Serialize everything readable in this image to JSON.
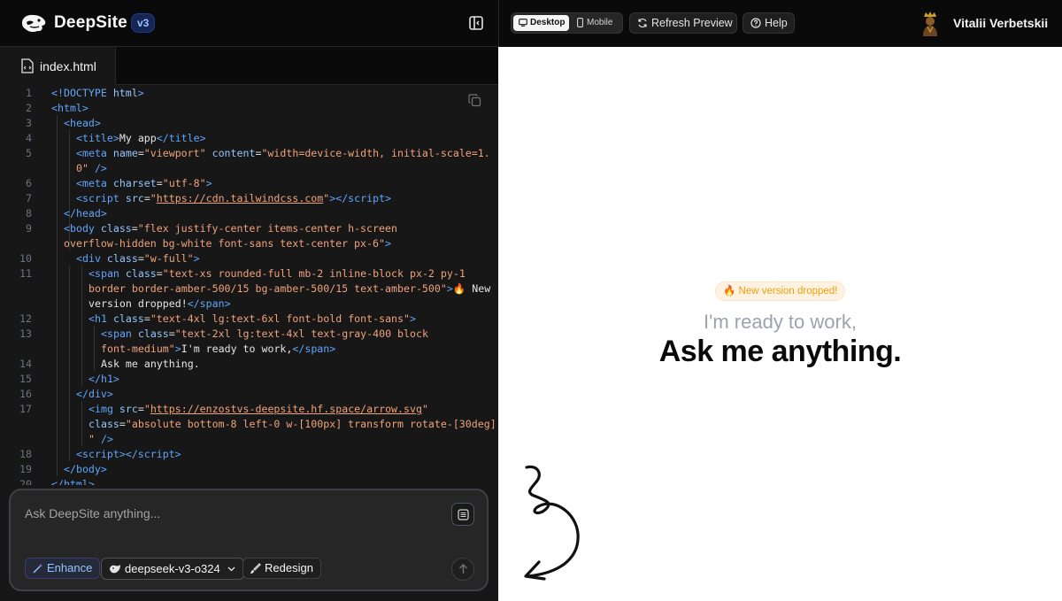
{
  "header": {
    "brand": "DeepSite",
    "version": "v3"
  },
  "file_tab": {
    "name": "index.html"
  },
  "code_lines": [
    {
      "n": "1",
      "html": "<span class='tg'>&lt;!DOCTYPE</span> <span class='at'>html</span><span class='tg'>&gt;</span>",
      "indent": 0
    },
    {
      "n": "2",
      "html": "<span class='tg'>&lt;html&gt;</span>",
      "indent": 0
    },
    {
      "n": "3",
      "html": "<span class='tg'>&lt;head&gt;</span>",
      "indent": 1
    },
    {
      "n": "4",
      "html": "<span class='tg'>&lt;title&gt;</span><span class='pl'>My app</span><span class='tg'>&lt;/title&gt;</span>",
      "indent": 2
    },
    {
      "n": "5",
      "html": "<span class='tg'>&lt;meta</span> <span class='at'>name</span>=<span class='st'>\"viewport\"</span> <span class='at'>content</span>=<span class='st'>\"width=device-width, initial-scale=1.</span>",
      "indent": 2
    },
    {
      "n": "",
      "html": "<span class='st'>0\"</span> <span class='tg'>/&gt;</span>",
      "indent": 2
    },
    {
      "n": "6",
      "html": "<span class='tg'>&lt;meta</span> <span class='at'>charset</span>=<span class='st'>\"utf-8\"</span><span class='tg'>&gt;</span>",
      "indent": 2
    },
    {
      "n": "7",
      "html": "<span class='tg'>&lt;script</span> <span class='at'>src</span>=<span class='st'>\"<span class='ul'>https://cdn.tailwindcss.com</span>\"</span><span class='tg'>&gt;&lt;/script&gt;</span>",
      "indent": 2
    },
    {
      "n": "8",
      "html": "<span class='tg'>&lt;/head&gt;</span>",
      "indent": 1
    },
    {
      "n": "9",
      "html": "<span class='tg'>&lt;body</span> <span class='at'>class</span>=<span class='st'>\"flex justify-center items-center h-screen</span>",
      "indent": 1
    },
    {
      "n": "",
      "html": "<span class='st'>overflow-hidden bg-white font-sans text-center px-6\"</span><span class='tg'>&gt;</span>",
      "indent": 1
    },
    {
      "n": "10",
      "html": "<span class='tg'>&lt;div</span> <span class='at'>class</span>=<span class='st'>\"w-full\"</span><span class='tg'>&gt;</span>",
      "indent": 2
    },
    {
      "n": "11",
      "html": "<span class='tg'>&lt;span</span> <span class='at'>class</span>=<span class='st'>\"text-xs rounded-full mb-2 inline-block px-2 py-1</span>",
      "indent": 3
    },
    {
      "n": "",
      "html": "<span class='st'>border border-amber-500/15 bg-amber-500/15 text-amber-500\"</span><span class='tg'>&gt;</span><span class='pl'>🔥 New</span>",
      "indent": 3
    },
    {
      "n": "",
      "html": "<span class='pl'>version dropped!</span><span class='tg'>&lt;/span&gt;</span>",
      "indent": 3
    },
    {
      "n": "12",
      "html": "<span class='tg'>&lt;h1</span> <span class='at'>class</span>=<span class='st'>\"text-4xl lg:text-6xl font-bold font-sans\"</span><span class='tg'>&gt;</span>",
      "indent": 3
    },
    {
      "n": "13",
      "html": "<span class='tg'>&lt;span</span> <span class='at'>class</span>=<span class='st'>\"text-2xl lg:text-4xl text-gray-400 block</span>",
      "indent": 4
    },
    {
      "n": "",
      "html": "<span class='st'>font-medium\"</span><span class='tg'>&gt;</span><span class='pl'>I'm ready to work,</span><span class='tg'>&lt;/span&gt;</span>",
      "indent": 4
    },
    {
      "n": "14",
      "html": "<span class='pl'>Ask me anything.</span>",
      "indent": 4
    },
    {
      "n": "15",
      "html": "<span class='tg'>&lt;/h1&gt;</span>",
      "indent": 3
    },
    {
      "n": "16",
      "html": "<span class='tg'>&lt;/div&gt;</span>",
      "indent": 2
    },
    {
      "n": "17",
      "html": "<span class='tg'>&lt;img</span> <span class='at'>src</span>=<span class='st'>\"<span class='ul'>https://enzostvs-deepsite.hf.space/arrow.svg</span>\"</span>",
      "indent": 3
    },
    {
      "n": "",
      "html": "<span class='at'>class</span>=<span class='st'>\"absolute bottom-8 left-0 w-[100px] transform rotate-[30deg]</span>",
      "indent": 3
    },
    {
      "n": "",
      "html": "<span class='st'>\"</span> <span class='tg'>/&gt;</span>",
      "indent": 3
    },
    {
      "n": "18",
      "html": "<span class='tg'>&lt;script&gt;&lt;/script&gt;</span>",
      "indent": 2
    },
    {
      "n": "19",
      "html": "<span class='tg'>&lt;/body&gt;</span>",
      "indent": 1
    },
    {
      "n": "20",
      "html": "<span class='tg'>&lt;/html&gt;</span>",
      "indent": 0
    }
  ],
  "prompt": {
    "placeholder": "Ask DeepSite anything...",
    "enhance_label": "Enhance",
    "model_label": "deepseek-v3-o324",
    "redesign_label": "Redesign"
  },
  "preview_toolbar": {
    "desktop_label": "Desktop",
    "mobile_label": "Mobile",
    "refresh_label": "Refresh Preview",
    "help_label": "Help",
    "user_name": "Vitalii Verbetskii"
  },
  "preview": {
    "badge": "🔥 New version dropped!",
    "subheading": "I'm ready to work,",
    "heading": "Ask me anything."
  },
  "colors": {
    "accent_blue": "#3b82f6",
    "amber": "#f59e0b",
    "editor_bg": "#171717"
  }
}
